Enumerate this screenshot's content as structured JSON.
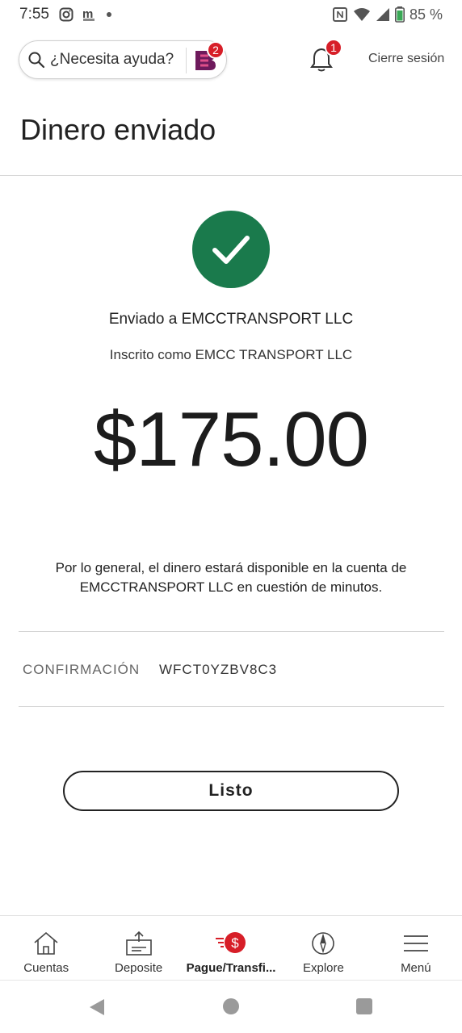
{
  "status_bar": {
    "time": "7:55",
    "battery": "85 %"
  },
  "header": {
    "search_placeholder": "¿Necesita ayuda?",
    "assistant_badge": "2",
    "notifications_badge": "1",
    "logout_label": "Cierre sesión"
  },
  "page": {
    "title": "Dinero enviado"
  },
  "confirmation": {
    "sent_to": "Enviado a EMCCTRANSPORT LLC",
    "enrolled_as": "Inscrito como EMCC TRANSPORT LLC",
    "amount": "$175.00",
    "info_text": "Por lo general, el dinero estará disponible en la cuenta de EMCCTRANSPORT LLC en cuestión de minutos.",
    "label": "CONFIRMACIÓN",
    "value": "WFCT0YZBV8C3",
    "done_label": "Listo"
  },
  "bottom_nav": {
    "items": [
      {
        "label": "Cuentas",
        "icon": "home-icon"
      },
      {
        "label": "Deposite",
        "icon": "deposit-icon"
      },
      {
        "label": "Pague/Transfi...",
        "icon": "pay-transfer-icon",
        "active": true
      },
      {
        "label": "Explore",
        "icon": "compass-icon"
      },
      {
        "label": "Menú",
        "icon": "menu-icon"
      }
    ]
  },
  "colors": {
    "success_green": "#1a7a4c",
    "badge_red": "#d71e28",
    "assistant_purple": "#6e1a5c"
  }
}
